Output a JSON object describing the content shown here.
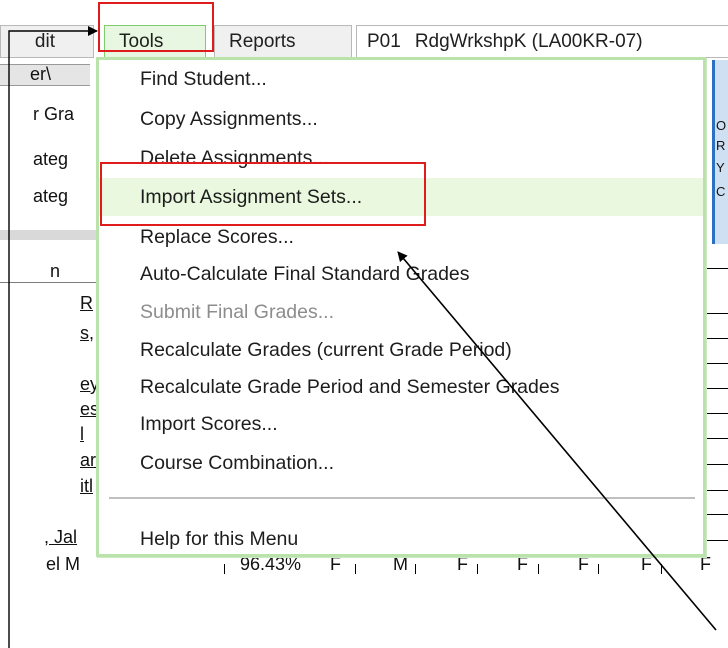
{
  "menubar": {
    "edit_label": "dit",
    "tools_label": "Tools",
    "reports_label": "Reports",
    "section_code": "P01",
    "section_name": "RdgWrkshpK (LA00KR-07)"
  },
  "background": {
    "tab_text": "er\\",
    "row_labels": [
      "r Gra",
      "ateg",
      "ateg",
      "n"
    ],
    "student_fragments": [
      "R",
      "s,",
      "ey",
      "es",
      "l",
      "ar",
      "itl",
      ", Jal",
      "el M"
    ],
    "bottom_row_values": [
      "96.43%",
      "F",
      "M",
      "F",
      "F",
      "F",
      "F",
      "F"
    ],
    "right_header_chars": [
      "O",
      "R",
      "Y",
      "C"
    ]
  },
  "tools_menu": {
    "items": [
      {
        "label": "Find Student...",
        "state": "normal"
      },
      {
        "label": "Copy Assignments...",
        "state": "normal"
      },
      {
        "label": "Delete Assignments...",
        "state": "normal"
      },
      {
        "label": "Import Assignment Sets...",
        "state": "highlighted"
      },
      {
        "label": "Replace Scores...",
        "state": "normal"
      },
      {
        "label": "Auto-Calculate Final Standard Grades",
        "state": "normal"
      },
      {
        "label": "Submit Final Grades...",
        "state": "disabled"
      },
      {
        "label": "Recalculate Grades (current Grade Period)",
        "state": "normal"
      },
      {
        "label": "Recalculate Grade Period and Semester Grades",
        "state": "normal"
      },
      {
        "label": "Import Scores...",
        "state": "normal"
      },
      {
        "label": "Course Combination...",
        "state": "normal"
      }
    ],
    "help_label": "Help for this Menu"
  },
  "colors": {
    "highlight": "#e9f8de",
    "menu_border": "#b9e3aa",
    "annotation": "#e01b1b"
  }
}
